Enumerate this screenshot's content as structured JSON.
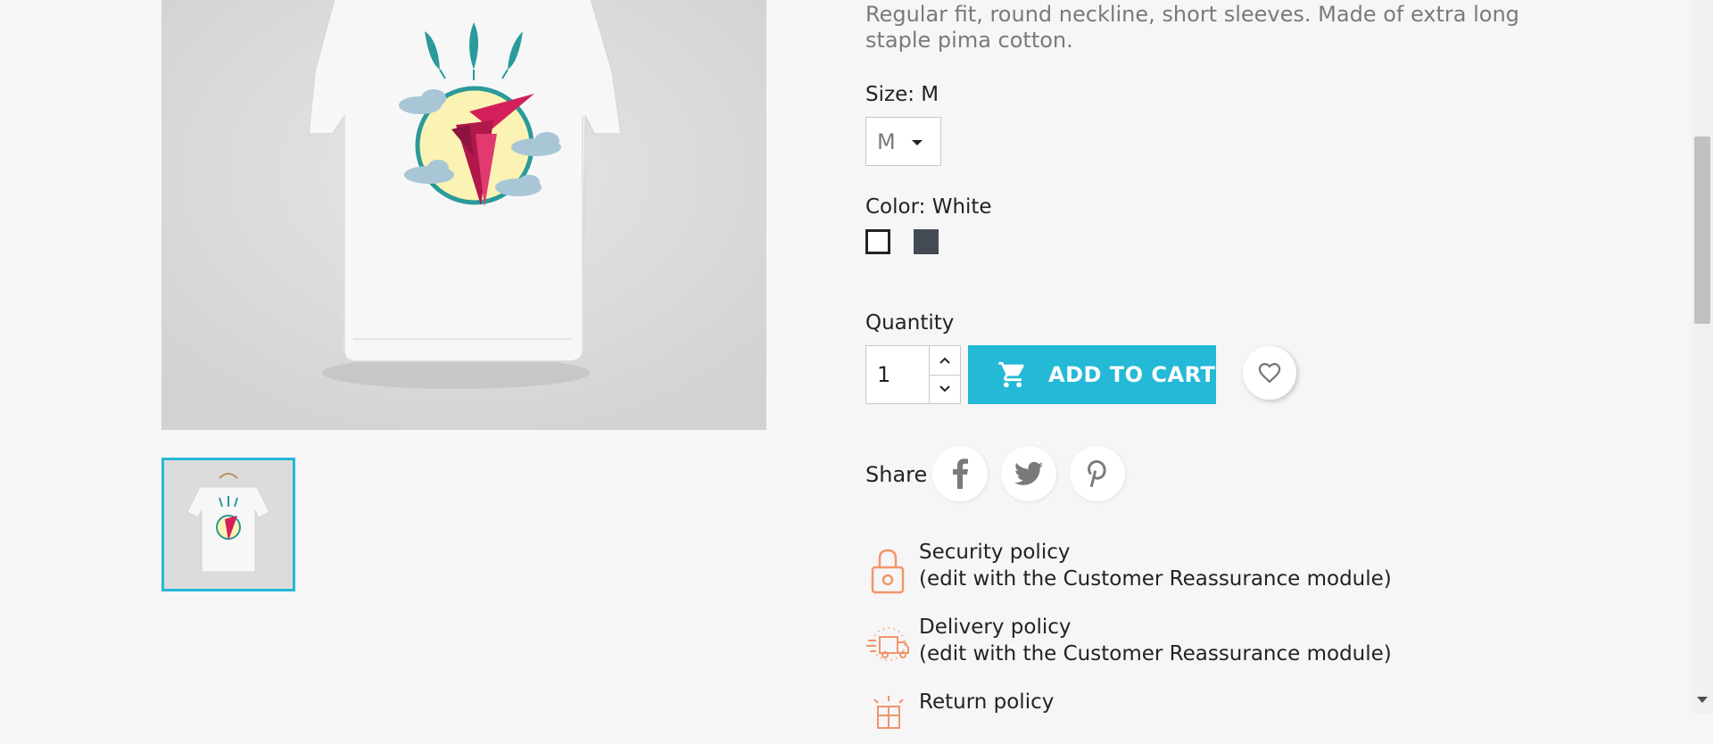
{
  "product": {
    "description": "Regular fit, round neckline, short sleeves. Made of extra long staple pima cotton.",
    "image_name": "t-shirt-hummingbird",
    "thumbnail_name": "t-shirt-hummingbird-thumbnail"
  },
  "size": {
    "label": "Size: M",
    "selected": "M"
  },
  "color": {
    "label": "Color: White",
    "swatches": [
      {
        "name": "White",
        "hex": "#ffffff",
        "selected": true
      },
      {
        "name": "Black",
        "hex": "#434a54",
        "selected": false
      }
    ]
  },
  "quantity": {
    "label": "Quantity",
    "value": "1"
  },
  "cart": {
    "add_label": "ADD TO CART",
    "accent": "#24b9d7"
  },
  "wishlist": {
    "icon": "heart-outline-icon"
  },
  "share": {
    "label": "Share",
    "networks": [
      "facebook",
      "twitter",
      "pinterest"
    ]
  },
  "policies": [
    {
      "title": "Security policy",
      "subtitle": "(edit with the Customer Reassurance module)",
      "icon": "lock-icon"
    },
    {
      "title": "Delivery policy",
      "subtitle": "(edit with the Customer Reassurance module)",
      "icon": "delivery-truck-icon"
    },
    {
      "title": "Return policy",
      "icon": "return-box-icon"
    }
  ]
}
